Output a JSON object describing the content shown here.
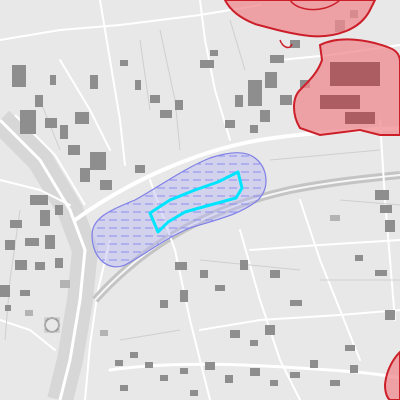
{
  "map": {
    "basemap_style": "grayscale",
    "colors": {
      "background": "#e8e8e8",
      "road": "#ffffff",
      "road_outline": "#cfcfcf",
      "building": "#8e8e8e",
      "building_light": "#b3b3b3",
      "rail": "#c4c4c4",
      "buffer_zone_fill": "#b9b9f3",
      "buffer_zone_stroke": "#7f7fe6",
      "buffer_hatch": "#8f8ff0",
      "highlight_outline": "#00e5ff",
      "restricted_fill": "#f08a8f",
      "restricted_stroke": "#cc1f2a"
    },
    "overlays": [
      {
        "kind": "buffer-zone",
        "style": "hatched-blue"
      },
      {
        "kind": "selected-parcel",
        "style": "cyan-outline"
      },
      {
        "kind": "restricted-area",
        "style": "red-fill",
        "count": 3
      }
    ]
  }
}
